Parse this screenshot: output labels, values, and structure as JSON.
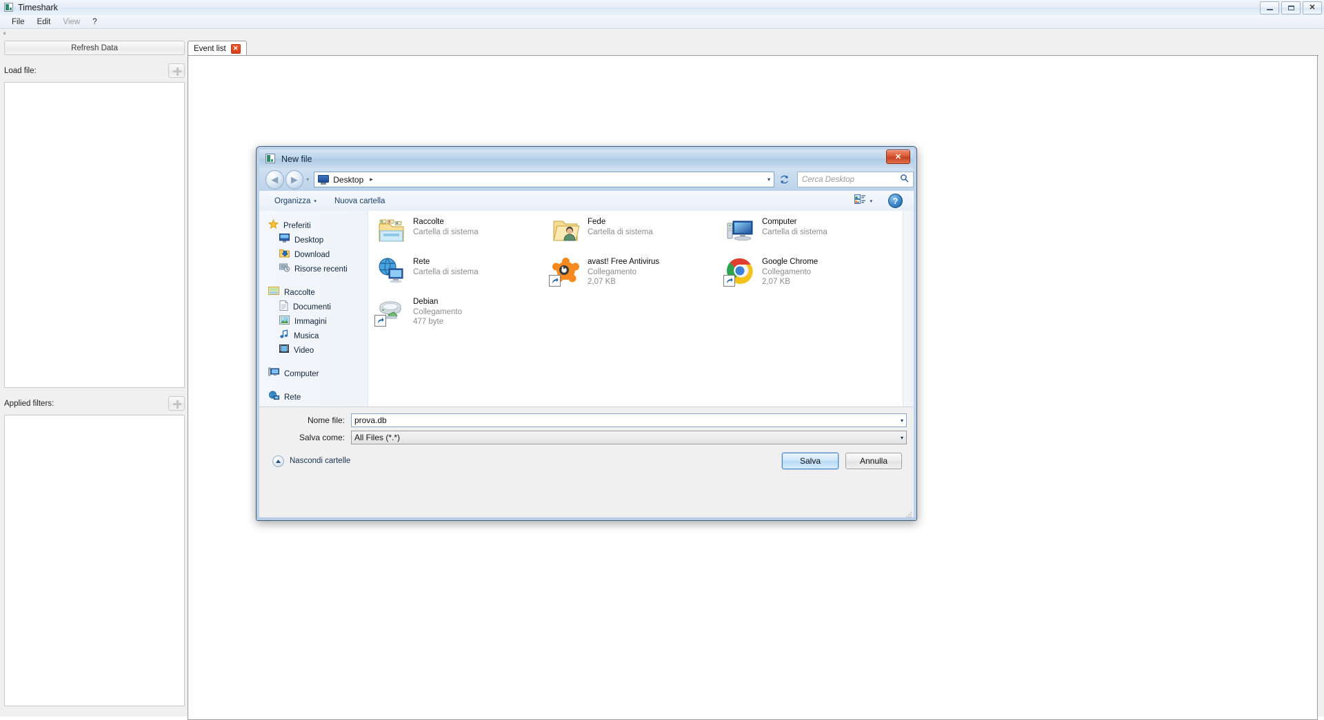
{
  "window": {
    "title": "Timeshark",
    "icon": "app-icon",
    "controls": {
      "minimize": "–",
      "maximize": "▭",
      "close": "✕"
    }
  },
  "menu": {
    "items": [
      {
        "label": "File",
        "enabled": true
      },
      {
        "label": "Edit",
        "enabled": true
      },
      {
        "label": "View",
        "enabled": false
      },
      {
        "label": "?",
        "enabled": true
      }
    ]
  },
  "left_panel": {
    "refresh_button": "Refresh Data",
    "load_file_label": "Load file:",
    "load_file_add_button": "+",
    "applied_filters_label": "Applied filters:",
    "applied_filters_add_button": "+"
  },
  "tabs": [
    {
      "label": "Event list",
      "close": "✕",
      "active": true
    }
  ],
  "dialog": {
    "title": "New file",
    "close_button": "✕",
    "nav": {
      "back": "◀",
      "forward": "▶",
      "history_caret": "▾",
      "address_icon": "desktop-icon",
      "address_text": "Desktop",
      "address_separator": "▸",
      "address_dropdown": "▾",
      "refresh": "refresh-icon"
    },
    "search": {
      "placeholder": "Cerca Desktop",
      "icon": "search-icon"
    },
    "toolbar": {
      "organize": "Organizza",
      "organize_caret": "▾",
      "new_folder": "Nuova cartella",
      "view_mode_icon": "view-mode-icon",
      "view_caret": "▾",
      "help": "?"
    },
    "sidebar": [
      {
        "label": "Preferiti",
        "icon": "star-icon",
        "level": 0
      },
      {
        "label": "Desktop",
        "icon": "desktop-icon",
        "level": 1
      },
      {
        "label": "Download",
        "icon": "download-folder-icon",
        "level": 1
      },
      {
        "label": "Risorse recenti",
        "icon": "recent-places-icon",
        "level": 1
      },
      {
        "label": "Raccolte",
        "icon": "libraries-icon",
        "level": 0,
        "gap_before": true
      },
      {
        "label": "Documenti",
        "icon": "documents-icon",
        "level": 1
      },
      {
        "label": "Immagini",
        "icon": "pictures-icon",
        "level": 1
      },
      {
        "label": "Musica",
        "icon": "music-icon",
        "level": 1
      },
      {
        "label": "Video",
        "icon": "video-icon",
        "level": 1
      },
      {
        "label": "Computer",
        "icon": "computer-icon",
        "level": 0,
        "gap_before": true
      },
      {
        "label": "Rete",
        "icon": "network-icon",
        "level": 0,
        "gap_before": true
      }
    ],
    "files": {
      "columns": [
        [
          {
            "name": "Raccolte",
            "type": "Cartella di sistema",
            "size": "",
            "icon": "libraries-folder-icon",
            "shortcut": false
          },
          {
            "name": "Rete",
            "type": "Cartella di sistema",
            "size": "",
            "icon": "network-icon",
            "shortcut": false
          },
          {
            "name": "Debian",
            "type": "Collegamento",
            "size": "477 byte",
            "icon": "debian-drive-icon",
            "shortcut": true
          }
        ],
        [
          {
            "name": "Fede",
            "type": "Cartella di sistema",
            "size": "",
            "icon": "user-folder-icon",
            "shortcut": false
          },
          {
            "name": "avast! Free Antivirus",
            "type": "Collegamento",
            "size": "2,07 KB",
            "icon": "avast-icon",
            "shortcut": true
          }
        ],
        [
          {
            "name": "Computer",
            "type": "Cartella di sistema",
            "size": "",
            "icon": "computer-icon",
            "shortcut": false
          },
          {
            "name": "Google Chrome",
            "type": "Collegamento",
            "size": "2,07 KB",
            "icon": "chrome-icon",
            "shortcut": true
          }
        ]
      ]
    },
    "form": {
      "filename_label": "Nome file:",
      "filename_value": "prova.db",
      "filename_caret": "▾",
      "filetype_label": "Salva come:",
      "filetype_value": "All Files (*.*)",
      "filetype_caret": "▾"
    },
    "footer": {
      "hide_folders": "Nascondi cartelle",
      "hide_folders_caret": "▴",
      "save_button": "Salva",
      "cancel_button": "Annulla"
    }
  },
  "colors": {
    "accent_blue": "#b6cde5",
    "close_red": "#d95a36",
    "tab_close_orange": "#e8501f",
    "title_gradient_top": "#d6e5f4",
    "title_gradient_bottom": "#c9dcef"
  }
}
